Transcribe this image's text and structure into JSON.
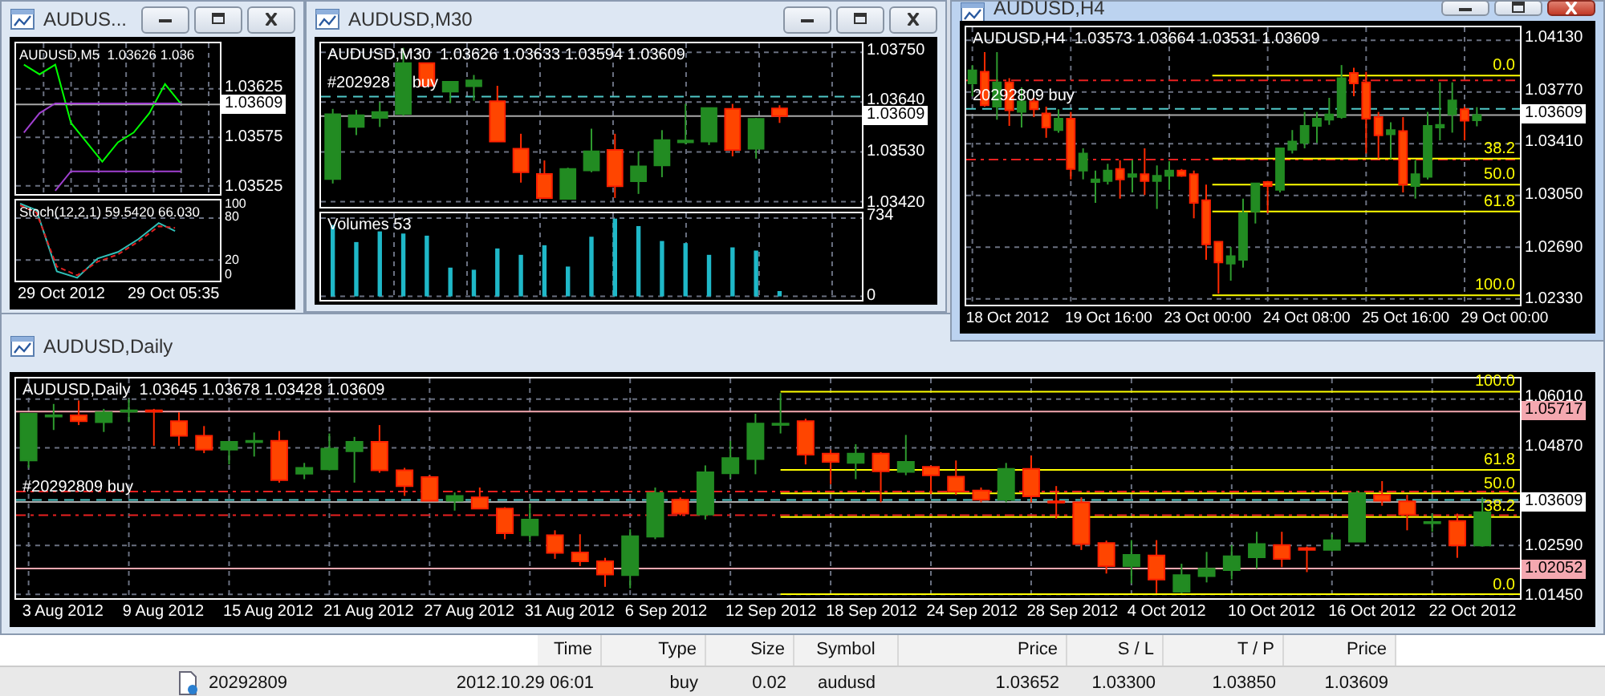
{
  "windows": [
    {
      "title": "AUDUS...",
      "active": false,
      "buttons": [
        {
          "kind": "minimize"
        },
        {
          "kind": "restore"
        },
        {
          "kind": "close"
        }
      ],
      "info": "AUDUSD,M5  1.03626 1.036",
      "chart_data": {
        "type": "line",
        "grid": true,
        "ylim": [
          1.03517,
          1.03672
        ],
        "yticks": [
          {
            "value": 1.03625,
            "label": "1.03625"
          },
          {
            "value": 1.03575,
            "label": "1.03575"
          },
          {
            "value": 1.03525,
            "label": "1.03525"
          }
        ],
        "series": [
          {
            "color": "#00ff00",
            "values": [
              1.0365,
              1.0364,
              1.0365,
              1.0359,
              1.0357,
              1.0355,
              1.0357,
              1.0358,
              1.036,
              1.0363,
              1.0361,
              null,
              null
            ]
          },
          {
            "color": "#a040d0",
            "values": [
              1.0358,
              1.036,
              1.0361,
              1.0361,
              1.0361,
              1.0361,
              1.0361,
              1.0361,
              1.0361,
              1.0361,
              1.0361,
              null,
              null
            ]
          },
          {
            "color": "#a040d0",
            "values": [
              null,
              null,
              1.0352,
              1.0354,
              1.0354,
              1.0354,
              1.0354,
              1.0354,
              1.0354,
              1.0354,
              1.0354,
              null,
              null
            ]
          }
        ],
        "ref_lines": [
          {
            "axis": "y",
            "value": 1.03609,
            "label": "1.03609",
            "color": "#a8a8a8"
          }
        ]
      },
      "sub_panel": {
        "kind": "stochastic",
        "label": "Stoch(12,2,1) 59.5420 66.030",
        "ticks": [
          "100",
          "80",
          "20",
          "0"
        ]
      },
      "time_labels": [
        "29 Oct 2012",
        "29 Oct 05:35"
      ]
    },
    {
      "title": "AUDUSD,M30",
      "active": false,
      "buttons": [
        {
          "kind": "minimize"
        },
        {
          "kind": "restore"
        },
        {
          "kind": "close"
        }
      ],
      "info": "AUDUSD,M30  1.03626 1.03633 1.03594 1.03609",
      "overlay": {
        "order_label": "#202928     buy"
      },
      "chart_data": {
        "type": "candlestick",
        "grid": true,
        "categories": [
          null,
          null,
          null,
          null,
          null,
          null,
          null,
          null,
          null,
          null,
          null,
          null,
          null,
          null,
          null,
          null,
          null,
          null,
          null,
          null,
          null,
          null,
          null
        ],
        "ylim": [
          1.0341,
          1.0377
        ],
        "yticks": [
          {
            "value": 1.0375,
            "label": "1.03750"
          },
          {
            "value": 1.0364,
            "label": "1.03640"
          },
          {
            "value": 1.0353,
            "label": "1.03530"
          },
          {
            "value": 1.0342,
            "label": "1.03420"
          }
        ],
        "ohlc": [
          [
            1.0347,
            1.03625,
            1.0346,
            1.03613
          ],
          [
            1.03585,
            1.03623,
            1.03567,
            1.03611
          ],
          [
            1.03605,
            1.0364,
            1.03585,
            1.03618
          ],
          [
            1.03614,
            1.0376,
            1.0361,
            1.03726
          ],
          [
            1.03726,
            1.03726,
            1.03676,
            1.03676
          ],
          [
            1.03663,
            1.03685,
            1.03638,
            1.03685
          ],
          [
            1.03675,
            1.037,
            1.03643,
            1.03688
          ],
          [
            1.03642,
            1.03676,
            1.03553,
            1.03553
          ],
          [
            1.03537,
            1.0357,
            1.03462,
            1.03485
          ],
          [
            1.03481,
            1.03511,
            1.03428,
            1.03428
          ],
          [
            1.03426,
            1.03495,
            1.03426,
            1.03492
          ],
          [
            1.03489,
            1.03581,
            1.03485,
            1.03531
          ],
          [
            1.03534,
            1.0357,
            1.03428,
            1.03454
          ],
          [
            1.03465,
            1.03531,
            1.03437,
            1.03498
          ],
          [
            1.035,
            1.03578,
            1.03474,
            1.03556
          ],
          [
            1.03551,
            1.03636,
            1.03547,
            1.03555
          ],
          [
            1.03553,
            1.03627,
            1.03545,
            1.03627
          ],
          [
            1.03625,
            1.03636,
            1.0352,
            1.03534
          ],
          [
            1.03537,
            1.03605,
            1.03515,
            1.03603
          ],
          [
            1.03626,
            1.03633,
            1.03594,
            1.03609
          ],
          null,
          null,
          null
        ],
        "ref_lines": [
          {
            "axis": "y",
            "value": 1.03652,
            "color": "#50c8c8",
            "line_style": "dashed"
          },
          {
            "axis": "y",
            "value": 1.03609,
            "label": "1.03609",
            "color": "#a8a8a8"
          }
        ]
      },
      "sub_panel": {
        "kind": "volumes",
        "label": "Volumes 53",
        "chart_data": {
          "type": "bar",
          "grid": true,
          "ylim": [
            -40,
            780
          ],
          "yticks": [
            {
              "value": 734,
              "label": "734"
            },
            {
              "value": 0,
              "label": "0"
            }
          ],
          "series": [
            {
              "color": "#1fb8c8",
              "values": [
                670,
                510,
                610,
                590,
                570,
                270,
                250,
                450,
                390,
                480,
                280,
                560,
                730,
                660,
                520,
                500,
                390,
                460,
                430,
                50,
                null,
                null,
                null
              ]
            }
          ]
        }
      }
    },
    {
      "title": "AUDUSD,H4",
      "active": true,
      "buttons": [
        {
          "kind": "minimize"
        },
        {
          "kind": "restore"
        },
        {
          "kind": "close"
        }
      ],
      "info": "AUDUSD,H4  1.03573 1.03664 1.03531 1.03609",
      "time_labels": [
        "18 Oct 2012",
        "19 Oct 16:00",
        "23 Oct 00:00",
        "24 Oct 08:00",
        "25 Oct 16:00",
        "29 Oct 00:00"
      ],
      "overlay": {
        "order_label": "20292809 buy",
        "fib_levels": [
          "0.0",
          "38.2",
          "50.0",
          "61.8",
          "100.0"
        ]
      },
      "chart_data": {
        "type": "candlestick",
        "grid": true,
        "categories": [
          null,
          null,
          null,
          null,
          null,
          null,
          null,
          null,
          null,
          null,
          null,
          null,
          null,
          null,
          null,
          null,
          null,
          null,
          null,
          null,
          null,
          null,
          null,
          null,
          null,
          null,
          null,
          null,
          null,
          null,
          null,
          null,
          null,
          null,
          null,
          null,
          null,
          null,
          null,
          null,
          null,
          null,
          null,
          null,
          null
        ],
        "ylim": [
          1.0229,
          1.0422
        ],
        "yticks": [
          {
            "value": 1.0413,
            "label": "1.04130"
          },
          {
            "value": 1.0377,
            "label": "1.03770"
          },
          {
            "value": 1.0341,
            "label": "1.03410"
          },
          {
            "value": 1.0305,
            "label": "1.03050"
          },
          {
            "value": 1.0269,
            "label": "1.02690"
          },
          {
            "value": 1.0233,
            "label": "1.02330"
          }
        ],
        "ohlc": [
          [
            1.0383,
            1.03957,
            1.0374,
            1.0392
          ],
          [
            1.0391,
            1.04047,
            1.03668,
            1.03678
          ],
          [
            1.03668,
            1.04047,
            1.03577,
            1.03837
          ],
          [
            1.03837,
            1.03866,
            1.03534,
            1.03642
          ],
          [
            1.03631,
            1.03801,
            1.03523,
            1.03704
          ],
          [
            1.03704,
            1.03729,
            1.03595,
            1.03649
          ],
          [
            1.03621,
            1.03668,
            1.03451,
            1.03523
          ],
          [
            1.03505,
            1.03649,
            1.03487,
            1.03584
          ],
          [
            1.03584,
            1.03631,
            1.03162,
            1.03234
          ],
          [
            1.03223,
            1.03378,
            1.03162,
            1.03342
          ],
          [
            1.03144,
            1.03223,
            1.02999,
            1.03162
          ],
          [
            1.03151,
            1.0327,
            1.03126,
            1.03223
          ],
          [
            1.03234,
            1.03295,
            1.03028,
            1.03162
          ],
          [
            1.0318,
            1.03295,
            1.03071,
            1.03198
          ],
          [
            1.03198,
            1.03378,
            1.03053,
            1.03151
          ],
          [
            1.03151,
            1.03259,
            1.02956,
            1.03187
          ],
          [
            1.03187,
            1.03288,
            1.03089,
            1.03223
          ],
          [
            1.03223,
            1.03234,
            1.0318,
            1.03187
          ],
          [
            1.03198,
            1.03223,
            1.02891,
            1.02999
          ],
          [
            1.03017,
            1.03126,
            1.02602,
            1.0271
          ],
          [
            1.02728,
            1.02728,
            1.02367,
            1.02584
          ],
          [
            1.02576,
            1.02692,
            1.02457,
            1.02627
          ],
          [
            1.02602,
            1.03028,
            1.02548,
            1.02927
          ],
          [
            1.02938,
            1.03133,
            1.02855,
            1.03133
          ],
          [
            1.03144,
            1.03151,
            1.02927,
            1.03115
          ],
          [
            1.03089,
            1.03378,
            1.03071,
            1.03378
          ],
          [
            1.03368,
            1.03505,
            1.03342,
            1.03425
          ],
          [
            1.03415,
            1.03631,
            1.03378,
            1.03534
          ],
          [
            1.03534,
            1.03631,
            1.03415,
            1.03584
          ],
          [
            1.03577,
            1.03729,
            1.03541,
            1.03613
          ],
          [
            1.03595,
            1.03957,
            1.03584,
            1.03866
          ],
          [
            1.03902,
            1.03939,
            1.0374,
            1.0383
          ],
          [
            1.03837,
            1.0391,
            1.03342,
            1.03584
          ],
          [
            1.03595,
            1.03631,
            1.03306,
            1.03469
          ],
          [
            1.03476,
            1.03559,
            1.03306,
            1.03505
          ],
          [
            1.03498,
            1.03595,
            1.03071,
            1.03126
          ],
          [
            1.03115,
            1.03295,
            1.03028,
            1.03198
          ],
          [
            1.0318,
            1.03631,
            1.03162,
            1.03534
          ],
          [
            1.03523,
            1.03837,
            1.03433,
            1.03541
          ],
          [
            1.03613,
            1.03837,
            1.03487,
            1.03711
          ],
          [
            1.03649,
            1.03668,
            1.03433,
            1.0357
          ],
          [
            1.03573,
            1.03664,
            1.03531,
            1.03609
          ],
          null,
          null,
          null
        ],
        "ref_lines": [
          {
            "axis": "y",
            "value": 1.0385,
            "color": "#e82020",
            "line_style": "dashdot"
          },
          {
            "axis": "y",
            "value": 1.03652,
            "color": "#50c8c8",
            "line_style": "dashed"
          },
          {
            "axis": "y",
            "value": 1.03609,
            "label": "1.03609",
            "color": "#a8a8a8"
          },
          {
            "axis": "y",
            "value": 1.033,
            "color": "#e82020",
            "line_style": "dashdot"
          },
          {
            "axis": "y",
            "value": 1.03884,
            "color": "#ffff00"
          },
          {
            "axis": "y",
            "value": 1.03306,
            "color": "#ffff00"
          },
          {
            "axis": "y",
            "value": 1.03126,
            "color": "#ffff00"
          },
          {
            "axis": "y",
            "value": 1.02938,
            "color": "#ffff00"
          },
          {
            "axis": "y",
            "value": 1.02356,
            "color": "#ffff00"
          }
        ]
      }
    },
    {
      "title": "AUDUSD,Daily",
      "active": false,
      "info": "AUDUSD,Daily  1.03645 1.03678 1.03428 1.03609",
      "time_labels": [
        "3 Aug 2012",
        "9 Aug 2012",
        "15 Aug 2012",
        "21 Aug 2012",
        "27 Aug 2012",
        "31 Aug 2012",
        "6 Sep 2012",
        "12 Sep 2012",
        "18 Sep 2012",
        "24 Sep 2012",
        "28 Sep 2012",
        "4 Oct 2012",
        "10 Oct 2012",
        "16 Oct 2012",
        "22 Oct 2012"
      ],
      "overlay": {
        "order_label": "#20292809 buy",
        "fib_levels": [
          "100.0",
          "61.8",
          "50.0",
          "38.2",
          "0.0"
        ]
      },
      "chart_data": {
        "type": "candlestick",
        "grid": true,
        "categories": [
          null,
          null,
          null,
          null,
          null,
          null,
          null,
          null,
          null,
          null,
          null,
          null,
          null,
          null,
          null,
          null,
          null,
          null,
          null,
          null,
          null,
          null,
          null,
          null,
          null,
          null,
          null,
          null,
          null,
          null,
          null,
          null,
          null,
          null,
          null,
          null,
          null,
          null,
          null,
          null,
          null,
          null,
          null,
          null,
          null,
          null,
          null,
          null,
          null,
          null,
          null,
          null,
          null,
          null,
          null,
          null,
          null,
          null,
          null,
          null
        ],
        "ylim": [
          1.0136,
          1.0649
        ],
        "yticks": [
          {
            "value": 1.0601,
            "label": "1.06010"
          },
          {
            "value": 1.0487,
            "label": "1.04870"
          },
          {
            "value": 1.0259,
            "label": "1.02590"
          },
          {
            "value": 1.0145,
            "label": "1.01450"
          }
        ],
        "ohlc": [
          [
            1.04575,
            1.05666,
            1.04403,
            1.05666
          ],
          [
            1.05631,
            1.05895,
            1.05287,
            1.05631
          ],
          [
            1.05631,
            1.05976,
            1.05402,
            1.05493
          ],
          [
            1.0547,
            1.0578,
            1.05241,
            1.057
          ],
          [
            1.05723,
            1.0601,
            1.0547,
            1.05746
          ],
          [
            1.05746,
            1.0578,
            1.04919,
            1.05723
          ],
          [
            1.05493,
            1.057,
            1.04919,
            1.05149
          ],
          [
            1.05149,
            1.05379,
            1.04747,
            1.04828
          ],
          [
            1.04828,
            1.05011,
            1.04483,
            1.05011
          ],
          [
            1.05034,
            1.05229,
            1.04667,
            1.05034
          ],
          [
            1.05034,
            1.05264,
            1.04058,
            1.04116
          ],
          [
            1.04265,
            1.04518,
            1.04139,
            1.04403
          ],
          [
            1.04368,
            1.05206,
            1.04345,
            1.04851
          ],
          [
            1.04793,
            1.05126,
            1.04058,
            1.05011
          ],
          [
            1.05011,
            1.05402,
            1.04288,
            1.04345
          ],
          [
            1.04345,
            1.04403,
            1.03748,
            1.03978
          ],
          [
            1.04185,
            1.04231,
            1.03634,
            1.03634
          ],
          [
            1.03634,
            1.03829,
            1.03404,
            1.03748
          ],
          [
            1.03714,
            1.03944,
            1.0345,
            1.0345
          ],
          [
            1.0345,
            1.03484,
            1.02738,
            1.02876
          ],
          [
            1.0283,
            1.03565,
            1.02681,
            1.03197
          ],
          [
            1.0283,
            1.02945,
            1.02279,
            1.02417
          ],
          [
            1.02428,
            1.02853,
            1.02107,
            1.02222
          ],
          [
            1.02222,
            1.02302,
            1.01625,
            1.01912
          ],
          [
            1.019,
            1.02968,
            1.0159,
            1.02807
          ],
          [
            1.02796,
            1.03944,
            1.02738,
            1.03817
          ],
          [
            1.03657,
            1.03714,
            1.03289,
            1.03335
          ],
          [
            1.03312,
            1.0446,
            1.03197,
            1.04299
          ],
          [
            1.04277,
            1.05034,
            1.04173,
            1.04632
          ],
          [
            1.04609,
            1.05666,
            1.04254,
            1.05436
          ],
          [
            1.05413,
            1.06148,
            1.05206,
            1.05436
          ],
          [
            1.05493,
            1.05551,
            1.04483,
            1.04713
          ],
          [
            1.04736,
            1.04828,
            1.04024,
            1.04541
          ],
          [
            1.04518,
            1.04954,
            1.04139,
            1.04736
          ],
          [
            1.04736,
            1.0477,
            1.03599,
            1.04322
          ],
          [
            1.04311,
            1.05172,
            1.04231,
            1.04541
          ],
          [
            1.04426,
            1.0446,
            1.03794,
            1.04231
          ],
          [
            1.04196,
            1.04575,
            1.03771,
            1.03852
          ],
          [
            1.03875,
            1.03944,
            1.03599,
            1.03657
          ],
          [
            1.03657,
            1.04518,
            1.03599,
            1.0438
          ],
          [
            1.0438,
            1.0469,
            1.03599,
            1.03737
          ],
          [
            1.03622,
            1.03978,
            1.0322,
            1.03611
          ],
          [
            1.03599,
            1.03714,
            1.02486,
            1.02623
          ],
          [
            1.02646,
            1.02704,
            1.01935,
            1.02107
          ],
          [
            1.02107,
            1.02715,
            1.01705,
            1.02371
          ],
          [
            1.02359,
            1.02715,
            1.01475,
            1.01797
          ],
          [
            1.0151,
            1.02164,
            1.01475,
            1.019
          ],
          [
            1.01877,
            1.0244,
            1.01728,
            1.02049
          ],
          [
            1.02015,
            1.026,
            1.01797,
            1.02336
          ],
          [
            1.02313,
            1.0291,
            1.02049,
            1.02623
          ],
          [
            1.026,
            1.0291,
            1.02084,
            1.02279
          ],
          [
            1.02532,
            1.02566,
            1.01969,
            1.02486
          ],
          [
            1.02486,
            1.02853,
            1.02451,
            1.02715
          ],
          [
            1.02681,
            1.03863,
            1.02681,
            1.03806
          ],
          [
            1.03771,
            1.04093,
            1.03519,
            1.03634
          ],
          [
            1.03622,
            1.03771,
            1.02945,
            1.03312
          ],
          [
            1.03117,
            1.03335,
            1.0291,
            1.0314
          ],
          [
            1.03163,
            1.03335,
            1.02302,
            1.02589
          ],
          [
            1.02589,
            1.03714,
            1.02566,
            1.0337
          ],
          null
        ],
        "ref_lines": [
          {
            "axis": "y",
            "value": 1.05717,
            "label": "1.05717",
            "color": "#f4a8b0"
          },
          {
            "axis": "y",
            "value": 1.0385,
            "color": "#e82020",
            "line_style": "dashdot"
          },
          {
            "axis": "y",
            "value": 1.03652,
            "color": "#50c8c8",
            "line_style": "dashed"
          },
          {
            "axis": "y",
            "value": 1.03609,
            "label": "1.03609",
            "color": "#a8a8a8"
          },
          {
            "axis": "y",
            "value": 1.033,
            "color": "#e82020",
            "line_style": "dashdot"
          },
          {
            "axis": "y",
            "value": 1.02052,
            "label": "1.02052",
            "color": "#f4a8b0"
          },
          {
            "axis": "y",
            "value": 1.06182,
            "color": "#ffff00"
          },
          {
            "axis": "y",
            "value": 1.04357,
            "color": "#ffff00"
          },
          {
            "axis": "y",
            "value": 1.03806,
            "color": "#ffff00"
          },
          {
            "axis": "y",
            "value": 1.03255,
            "color": "#ffff00"
          },
          {
            "axis": "y",
            "value": 1.01452,
            "color": "#ffff00"
          }
        ]
      }
    }
  ],
  "trades": {
    "columns": [
      "Time",
      "Type",
      "Size",
      "Symbol",
      "Price",
      "S / L",
      "T / P",
      "Price"
    ],
    "rows": [
      {
        "ticket": "20292809",
        "cells": [
          "2012.10.29 06:01",
          "buy",
          "0.02",
          "audusd",
          "1.03652",
          "1.03300",
          "1.03850",
          "1.03609"
        ]
      }
    ]
  }
}
